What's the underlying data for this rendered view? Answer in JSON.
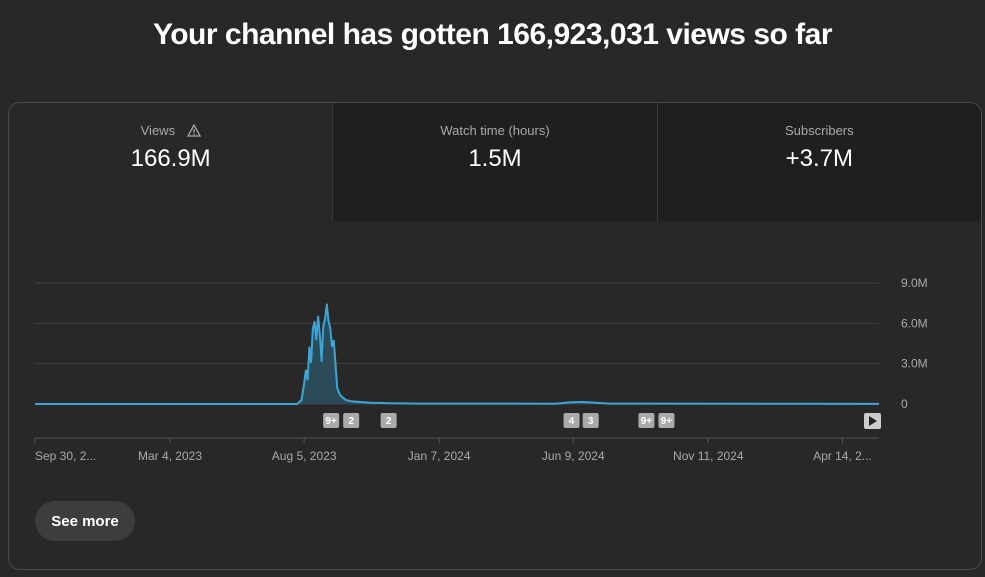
{
  "headline": "Your channel has gotten 166,923,031 views so far",
  "tabs": [
    {
      "label": "Views",
      "value": "166.9M",
      "icon": "warning-icon",
      "active": true
    },
    {
      "label": "Watch time (hours)",
      "value": "1.5M",
      "active": false
    },
    {
      "label": "Subscribers",
      "value": "+3.7M",
      "active": false
    }
  ],
  "see_more_label": "See more",
  "colors": {
    "line": "#3ea6d6",
    "area": "#2d4a58",
    "grid": "#3f3f3f",
    "marker": "#aaaaaa"
  },
  "chart_data": {
    "type": "area",
    "x_range": [
      "2022-09-30",
      "2025-05-26"
    ],
    "ylim": [
      0,
      9000000
    ],
    "y_ticks": [
      {
        "value": 9000000,
        "label": "9.0M"
      },
      {
        "value": 6000000,
        "label": "6.0M"
      },
      {
        "value": 3000000,
        "label": "3.0M"
      },
      {
        "value": 0,
        "label": "0"
      }
    ],
    "x_ticks": [
      {
        "date": "2022-09-30",
        "label": "Sep 30, 2..."
      },
      {
        "date": "2023-03-04",
        "label": "Mar 4, 2023"
      },
      {
        "date": "2023-08-05",
        "label": "Aug 5, 2023"
      },
      {
        "date": "2024-01-07",
        "label": "Jan 7, 2024"
      },
      {
        "date": "2024-06-09",
        "label": "Jun 9, 2024"
      },
      {
        "date": "2024-11-11",
        "label": "Nov 11, 2024"
      },
      {
        "date": "2025-04-14",
        "label": "Apr 14, 2..."
      }
    ],
    "series": [
      {
        "points": [
          [
            "2022-09-30",
            0
          ],
          [
            "2023-07-28",
            0
          ],
          [
            "2023-08-02",
            300000
          ],
          [
            "2023-08-05",
            1500000
          ],
          [
            "2023-08-07",
            2500000
          ],
          [
            "2023-08-09",
            1800000
          ],
          [
            "2023-08-11",
            4200000
          ],
          [
            "2023-08-13",
            3100000
          ],
          [
            "2023-08-15",
            5600000
          ],
          [
            "2023-08-17",
            6100000
          ],
          [
            "2023-08-19",
            4800000
          ],
          [
            "2023-08-21",
            6500000
          ],
          [
            "2023-08-23",
            5200000
          ],
          [
            "2023-08-25",
            3200000
          ],
          [
            "2023-08-27",
            5800000
          ],
          [
            "2023-08-29",
            6300000
          ],
          [
            "2023-08-31",
            7400000
          ],
          [
            "2023-09-02",
            6200000
          ],
          [
            "2023-09-04",
            5600000
          ],
          [
            "2023-09-06",
            4300000
          ],
          [
            "2023-09-08",
            4700000
          ],
          [
            "2023-09-10",
            3000000
          ],
          [
            "2023-09-12",
            1200000
          ],
          [
            "2023-09-15",
            700000
          ],
          [
            "2023-09-18",
            500000
          ],
          [
            "2023-09-22",
            300000
          ],
          [
            "2023-09-28",
            200000
          ],
          [
            "2023-10-08",
            150000
          ],
          [
            "2023-10-20",
            100000
          ],
          [
            "2023-11-10",
            60000
          ],
          [
            "2023-12-15",
            30000
          ],
          [
            "2024-05-20",
            20000
          ],
          [
            "2024-06-05",
            120000
          ],
          [
            "2024-06-20",
            150000
          ],
          [
            "2024-07-05",
            100000
          ],
          [
            "2024-07-20",
            30000
          ],
          [
            "2025-05-26",
            10000
          ]
        ]
      }
    ],
    "annotations": [
      {
        "date": "2023-09-05",
        "label": "9+"
      },
      {
        "date": "2023-09-28",
        "label": "2"
      },
      {
        "date": "2023-11-10",
        "label": "2"
      },
      {
        "date": "2024-06-07",
        "label": "4"
      },
      {
        "date": "2024-06-29",
        "label": "3"
      },
      {
        "date": "2024-09-01",
        "label": "9+"
      },
      {
        "date": "2024-09-24",
        "label": "9+"
      }
    ],
    "play_button_icon": "play-icon"
  }
}
